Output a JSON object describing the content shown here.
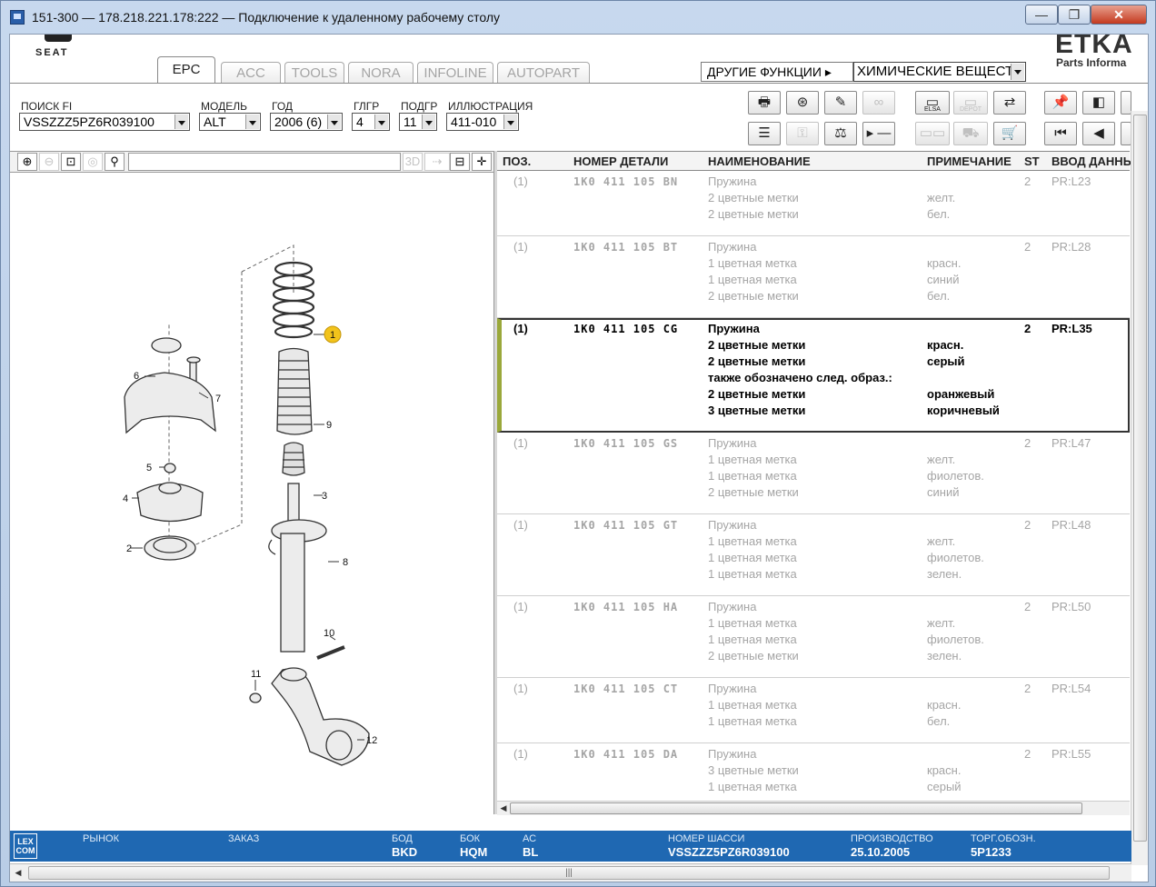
{
  "window": {
    "title": "151-300 — 178.218.221.178:222 — Подключение к удаленному рабочему столу"
  },
  "header": {
    "brand": "SEAT",
    "etka_logo": "ETKA",
    "etka_subtitle": "Parts Informa",
    "tabs": [
      "EPC",
      "ACC",
      "TOOLS",
      "NORA",
      "INFOLINE",
      "AUTOPART"
    ],
    "active_tab": "EPC",
    "other_functions_label": "ДРУГИЕ ФУНКЦИИ ▸",
    "other_functions_value": "ХИМИЧЕСКИЕ ВЕЩЕСТ"
  },
  "filters": {
    "search_fi": {
      "label": "ПОИСК FI",
      "value": "VSSZZZ5PZ6R039100"
    },
    "model": {
      "label": "МОДЕЛЬ",
      "value": "ALT"
    },
    "year": {
      "label": "ГОД",
      "value": "2006 (6)"
    },
    "main_group": {
      "label": "ГЛГР",
      "value": "4"
    },
    "sub_group": {
      "label": "ПОДГР",
      "value": "11"
    },
    "illustration": {
      "label": "ИЛЛЮСТРАЦИЯ",
      "value": "411-010"
    }
  },
  "toolbar": {
    "elsa": "ELSA",
    "depot": "DEPOT"
  },
  "illustration": {
    "callouts": [
      "1",
      "2",
      "3",
      "4",
      "5",
      "6",
      "7",
      "8",
      "9",
      "10",
      "11",
      "12"
    ],
    "highlight_color": "#f2c31b"
  },
  "table": {
    "headers": [
      "ПОЗ.",
      "НОМЕР ДЕТАЛИ",
      "НАИМЕНОВАНИЕ",
      "ПРИМЕЧАНИЕ",
      "ST",
      "ВВОД ДАННЫ"
    ],
    "rows": [
      {
        "pos": "(1)",
        "part": "1K0 411 105 BN",
        "lines": [
          [
            "Пружина",
            ""
          ],
          [
            "2 цветные метки",
            "желт."
          ],
          [
            "2 цветные метки",
            "бел."
          ]
        ],
        "st": "2",
        "entry": "PR:L23",
        "selected": false
      },
      {
        "pos": "(1)",
        "part": "1K0 411 105 BT",
        "lines": [
          [
            "Пружина",
            ""
          ],
          [
            "1 цветная метка",
            "красн."
          ],
          [
            "1 цветная метка",
            "синий"
          ],
          [
            "2 цветные метки",
            "бел."
          ]
        ],
        "st": "2",
        "entry": "PR:L28",
        "selected": false
      },
      {
        "pos": "(1)",
        "part": "1K0 411 105 CG",
        "lines": [
          [
            "Пружина",
            ""
          ],
          [
            "2 цветные метки",
            "красн."
          ],
          [
            "2 цветные метки",
            "серый"
          ],
          [
            "также обозначено след. образ.:",
            ""
          ],
          [
            "2 цветные метки",
            "оранжевый"
          ],
          [
            "3 цветные метки",
            "коричневый"
          ]
        ],
        "st": "2",
        "entry": "PR:L35",
        "selected": true
      },
      {
        "pos": "(1)",
        "part": "1K0 411 105 GS",
        "lines": [
          [
            "Пружина",
            ""
          ],
          [
            "1 цветная метка",
            "желт."
          ],
          [
            "1 цветная метка",
            "фиолетов."
          ],
          [
            "2 цветные метки",
            "синий"
          ]
        ],
        "st": "2",
        "entry": "PR:L47",
        "selected": false
      },
      {
        "pos": "(1)",
        "part": "1K0 411 105 GT",
        "lines": [
          [
            "Пружина",
            ""
          ],
          [
            "1 цветная метка",
            "желт."
          ],
          [
            "1 цветная метка",
            "фиолетов."
          ],
          [
            "1 цветная метка",
            "зелен."
          ]
        ],
        "st": "2",
        "entry": "PR:L48",
        "selected": false
      },
      {
        "pos": "(1)",
        "part": "1K0 411 105 HA",
        "lines": [
          [
            "Пружина",
            ""
          ],
          [
            "1 цветная метка",
            "желт."
          ],
          [
            "1 цветная метка",
            "фиолетов."
          ],
          [
            "2 цветные метки",
            "зелен."
          ]
        ],
        "st": "2",
        "entry": "PR:L50",
        "selected": false
      },
      {
        "pos": "(1)",
        "part": "1K0 411 105 CT",
        "lines": [
          [
            "Пружина",
            ""
          ],
          [
            "1 цветная метка",
            "красн."
          ],
          [
            "1 цветная метка",
            "бел."
          ]
        ],
        "st": "2",
        "entry": "PR:L54",
        "selected": false
      },
      {
        "pos": "(1)",
        "part": "1K0 411 105 DA",
        "lines": [
          [
            "Пружина",
            ""
          ],
          [
            "3 цветные метки",
            "красн."
          ],
          [
            "1 цветная метка",
            "серый"
          ]
        ],
        "st": "2",
        "entry": "PR:L55",
        "selected": false
      }
    ]
  },
  "status_bar": {
    "lexcom": "LEX COM",
    "market_label": "РЫНОК",
    "order_label": "ЗАКАЗ",
    "bod_label": "БОД",
    "bod_value": "BKD",
    "bok_label": "БОК",
    "bok_value": "HQM",
    "ac_label": "АС",
    "ac_value": "BL",
    "chassis_label": "НОМЕР ШАССИ",
    "chassis_value": "VSSZZZ5PZ6R039100",
    "production_label": "ПРОИЗВОДСТВО",
    "production_value": "25.10.2005",
    "trade_label": "ТОРГ.ОБОЗН.",
    "trade_value": "5P1233",
    "color": "#1f68b2"
  }
}
